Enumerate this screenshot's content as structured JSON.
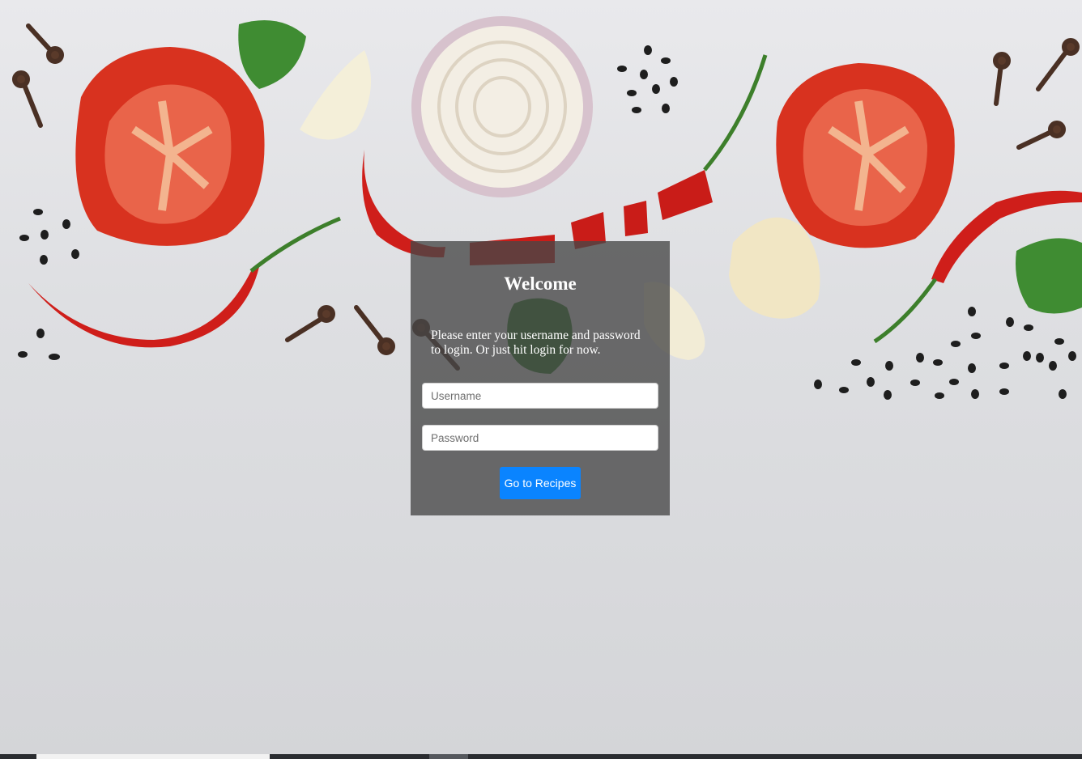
{
  "login": {
    "title": "Welcome",
    "message": "Please enter your username and password to login. Or just hit login for now.",
    "username_placeholder": "Username",
    "password_placeholder": "Password",
    "submit_label": "Go to Recipes"
  },
  "colors": {
    "panel_overlay": "#464646",
    "button": "#0a84ff",
    "background": "#e2e3e6"
  }
}
